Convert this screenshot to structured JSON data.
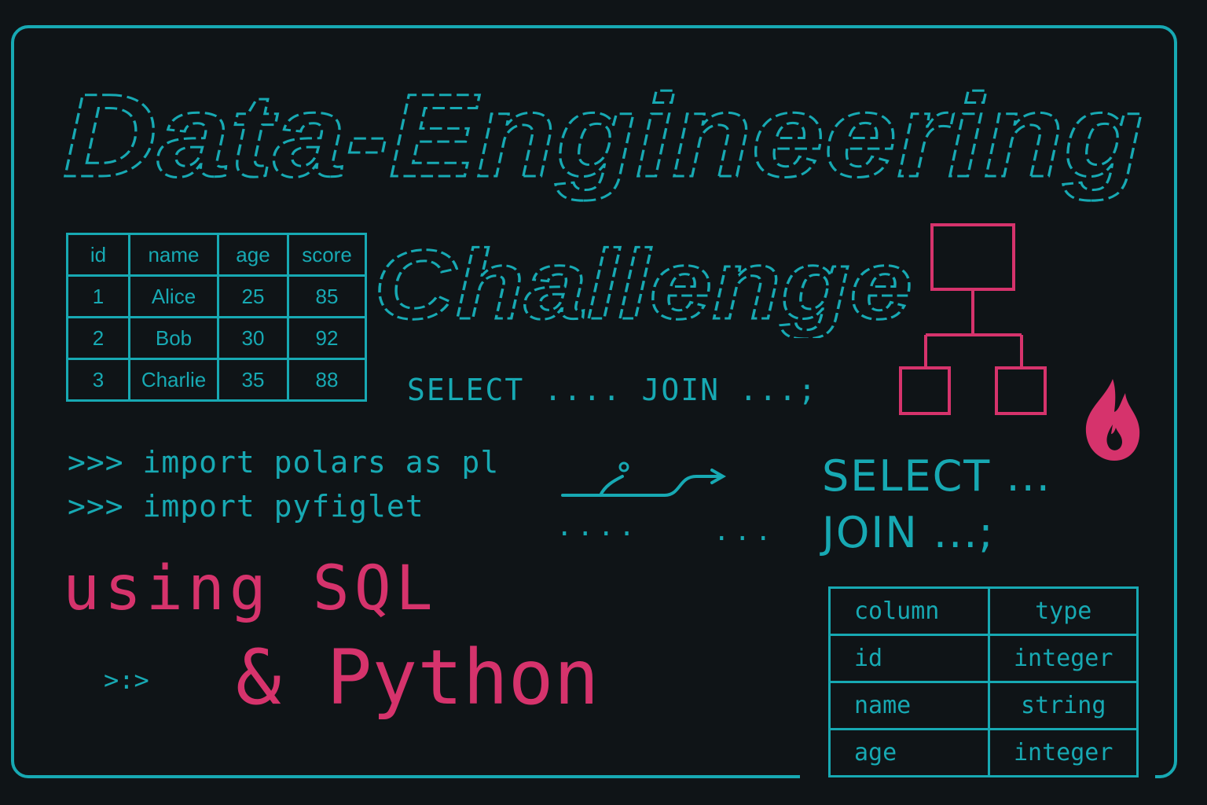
{
  "title": "Data-Engineering",
  "subtitle": "Challenge",
  "sample_table": {
    "headers": [
      "id",
      "name",
      "age",
      "score"
    ],
    "rows": [
      [
        "1",
        "Alice",
        "25",
        "85"
      ],
      [
        "2",
        "Bob",
        "30",
        "92"
      ],
      [
        "3",
        "Charlie",
        "35",
        "88"
      ]
    ]
  },
  "sql_inline": "SELECT .... JOIN ...;",
  "code_lines": [
    ">>> import polars as pl",
    ">>> import pyfiglet"
  ],
  "dots_left": "....",
  "dots_right": "...",
  "sql_big": {
    "line1": "SELECT ...",
    "line2": "JOIN ...;"
  },
  "using_line": "using SQL",
  "prompt": ">:>",
  "python_line": "& Python",
  "schema_table": {
    "headers": [
      "column",
      "type"
    ],
    "rows": [
      [
        "id",
        "integer"
      ],
      [
        "name",
        "string"
      ],
      [
        "age",
        "integer"
      ]
    ]
  },
  "icons": [
    "hierarchy-diagram-icon",
    "flame-icon",
    "arrow-curve-icon"
  ],
  "colors": {
    "background": "#0f1417",
    "teal": "#17a9b3",
    "pink": "#d6336c"
  }
}
